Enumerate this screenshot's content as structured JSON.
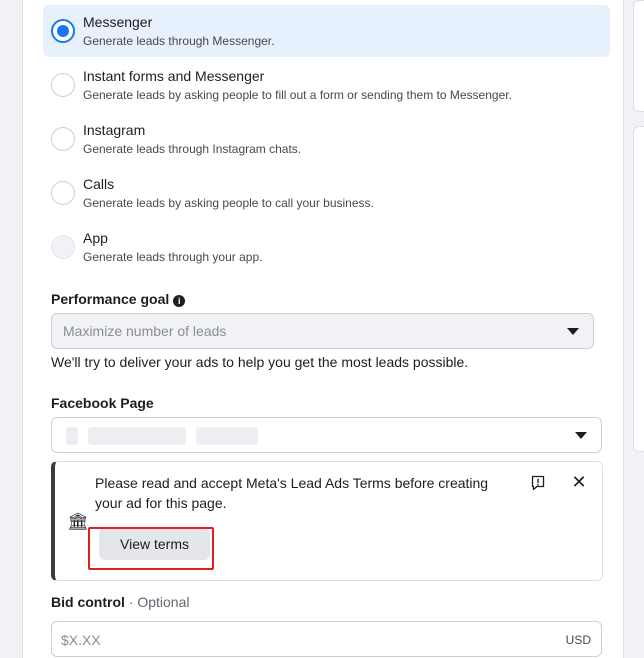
{
  "conversion_locations": [
    {
      "title": "Messenger",
      "subtitle": "Generate leads through Messenger.",
      "selected": true,
      "enabled": true
    },
    {
      "title": "Instant forms and Messenger",
      "subtitle": "Generate leads by asking people to fill out a form or sending them to Messenger.",
      "selected": false,
      "enabled": true
    },
    {
      "title": "Instagram",
      "subtitle": "Generate leads through Instagram chats.",
      "selected": false,
      "enabled": true
    },
    {
      "title": "Calls",
      "subtitle": "Generate leads by asking people to call your business.",
      "selected": false,
      "enabled": true
    },
    {
      "title": "App",
      "subtitle": "Generate leads through your app.",
      "selected": false,
      "enabled": false
    }
  ],
  "performance_goal": {
    "label": "Performance goal",
    "value": "Maximize number of leads",
    "helper": "We'll try to deliver your ads to help you get the most leads possible."
  },
  "facebook_page": {
    "label": "Facebook Page"
  },
  "lead_terms_notice": {
    "text": "Please read and accept Meta's Lead Ads Terms before creating your ad for this page.",
    "button_label": "View terms"
  },
  "bid_control": {
    "label": "Bid control",
    "optional_label": "· Optional",
    "placeholder": "$X.XX",
    "currency": "USD"
  },
  "colors": {
    "accent": "#1877f2",
    "selected_bg": "#e7f0fd",
    "highlight_border": "#e0201f"
  }
}
